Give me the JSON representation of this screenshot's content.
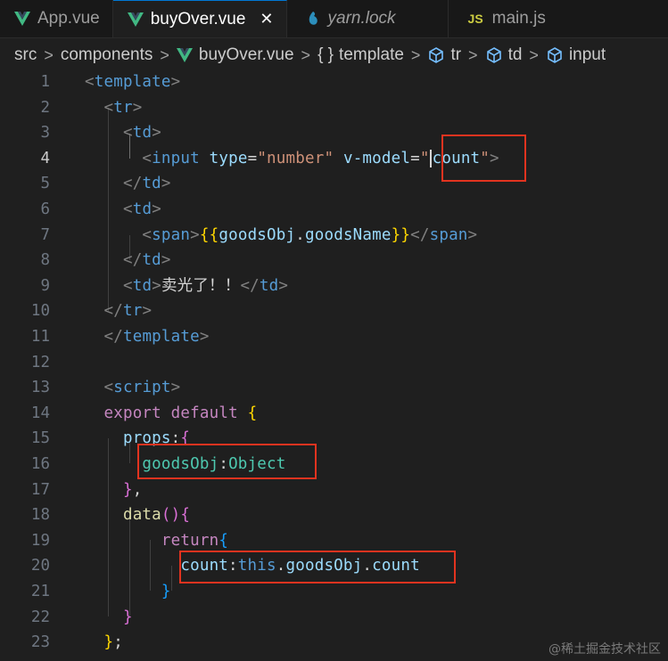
{
  "tabs": [
    {
      "label": "App.vue",
      "icon": "vue-icon",
      "active": false
    },
    {
      "label": "buyOver.vue",
      "icon": "vue-icon",
      "active": true,
      "close": "✕"
    },
    {
      "label": "yarn.lock",
      "icon": "yarn-icon",
      "active": false
    },
    {
      "label": "main.js",
      "icon": "js-icon",
      "badge": "JS",
      "active": false
    }
  ],
  "breadcrumb": {
    "items": [
      "src",
      "components",
      "buyOver.vue",
      "template",
      "tr",
      "td",
      "input"
    ],
    "separator": ">",
    "braces": "{ }"
  },
  "editor": {
    "current_line": 4,
    "line_numbers": [
      "1",
      "2",
      "3",
      "4",
      "5",
      "6",
      "7",
      "8",
      "9",
      "10",
      "11",
      "12",
      "13",
      "14",
      "15",
      "16",
      "17",
      "18",
      "19",
      "20",
      "21",
      "22",
      "23"
    ]
  },
  "colors": {
    "highlight_box": "#e2331f",
    "vue_green": "#41b883",
    "tab_accent": "#0078d4"
  },
  "watermark": "@稀土掘金技术社区"
}
